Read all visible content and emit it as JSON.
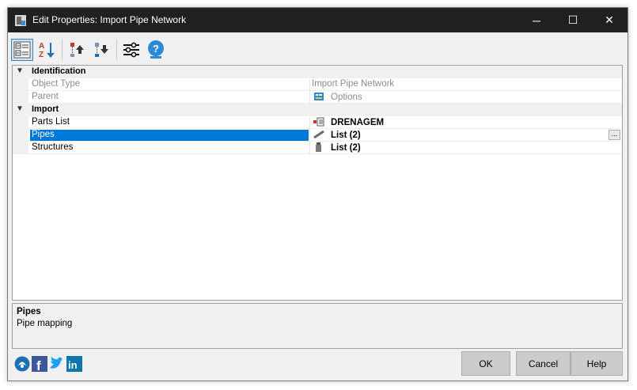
{
  "window": {
    "title": "Edit Properties: Import Pipe Network"
  },
  "window_controls": {
    "minimize": "─",
    "maximize": "☐",
    "close": "✕"
  },
  "toolbar": {
    "buttons": [
      {
        "icon": "categorized-view-icon",
        "active": true
      },
      {
        "icon": "alphabetical-sort-icon"
      },
      {
        "icon": "move-up-icon"
      },
      {
        "icon": "move-down-icon"
      },
      {
        "icon": "settings-sliders-icon"
      },
      {
        "icon": "help-icon"
      }
    ]
  },
  "grid": {
    "categories": [
      {
        "label": "Identification",
        "rows": [
          {
            "name": "Object Type",
            "value": "Import Pipe Network",
            "readonly": true
          },
          {
            "name": "Parent",
            "value": "Options",
            "readonly": true,
            "icon": "options-icon"
          }
        ]
      },
      {
        "label": "Import",
        "rows": [
          {
            "name": "Parts List",
            "value": "DRENAGEM",
            "icon": "parts-list-icon"
          },
          {
            "name": "Pipes",
            "value": "List (2)",
            "icon": "pipe-icon",
            "selected": true,
            "ellipsis": "..."
          },
          {
            "name": "Structures",
            "value": "List (2)",
            "icon": "structure-icon"
          }
        ]
      }
    ]
  },
  "description": {
    "title": "Pipes",
    "text": "Pipe mapping"
  },
  "social": [
    "home-icon",
    "facebook-icon",
    "twitter-icon",
    "linkedin-icon"
  ],
  "buttons": {
    "ok": "OK",
    "cancel": "Cancel",
    "help": "Help"
  },
  "colors": {
    "title_bar": "#202020",
    "selection": "#0078d7",
    "accent": "#1f6fb5"
  }
}
